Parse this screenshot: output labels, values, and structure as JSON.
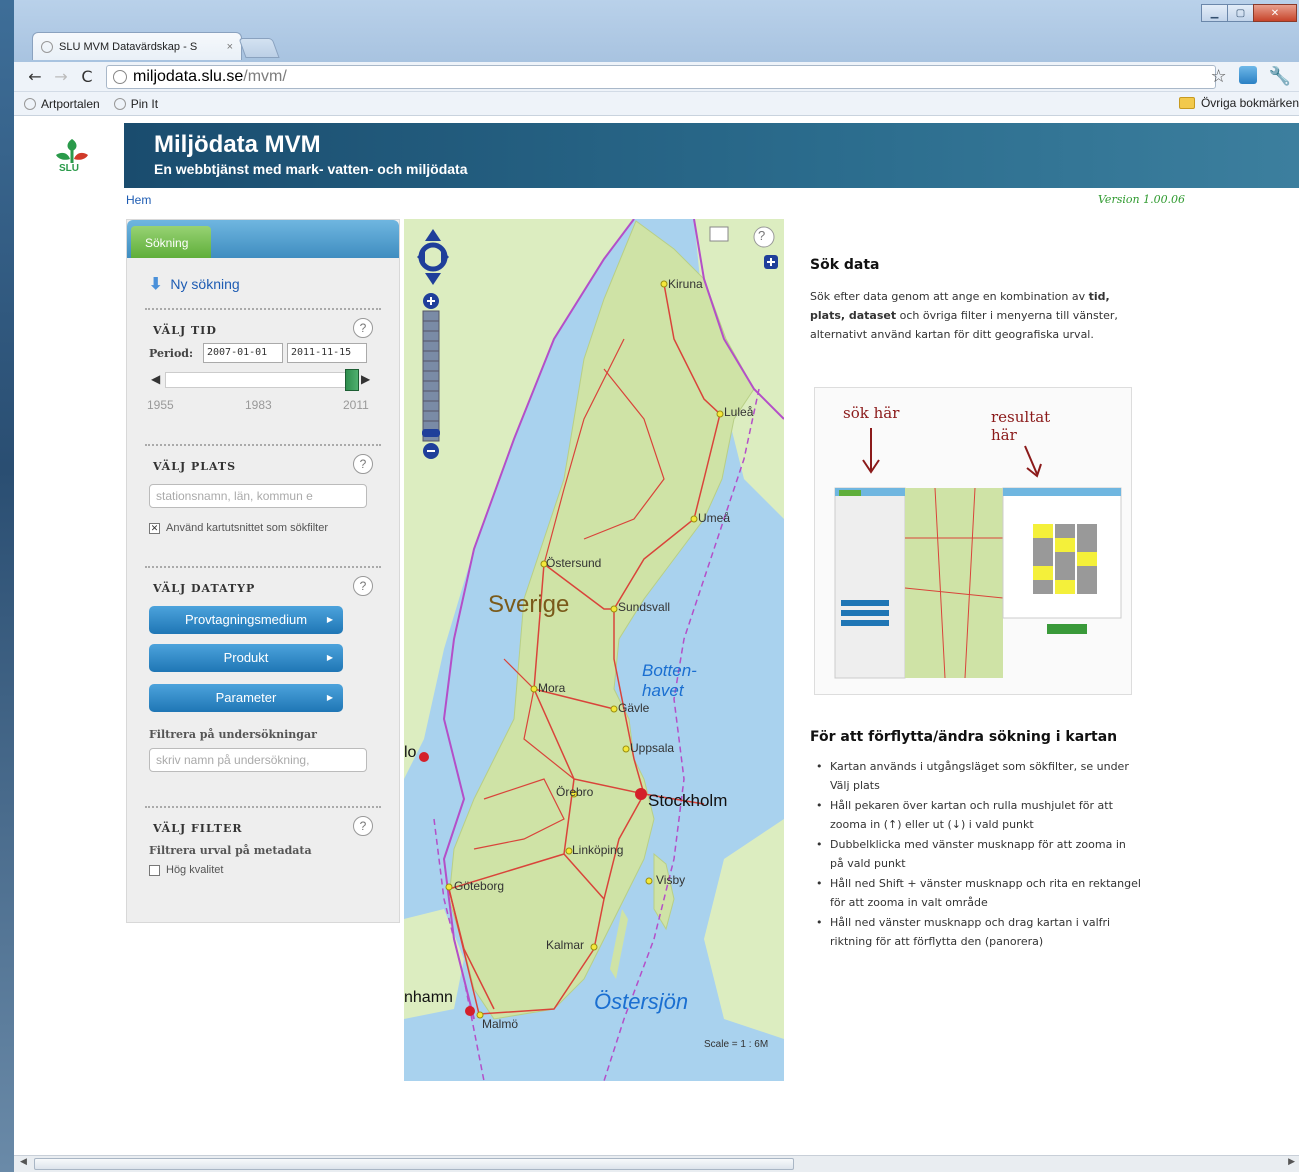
{
  "browser": {
    "tab_title": "SLU MVM Datavärdskap - S",
    "tab_close": "×",
    "url_domain": "miljodata.slu.se",
    "url_path": "/mvm/",
    "bookmarks": [
      "Artportalen",
      "Pin It"
    ],
    "bookmarks_right": "Övriga bokmärken"
  },
  "header": {
    "logo_text": "SLU",
    "title": "Miljödata MVM",
    "subtitle": "En webbtjänst med mark- vatten- och miljödata",
    "home_link": "Hem",
    "version": "Version 1.00.06"
  },
  "sidebar": {
    "tab_label": "Sökning",
    "new_search": "Ny sökning",
    "help_glyph": "?",
    "time": {
      "title": "VÄLJ TID",
      "period_label": "Period:",
      "from_date": "2007-01-01",
      "to_date": "2011-11-15",
      "ticks": [
        "1955",
        "1983",
        "2011"
      ]
    },
    "place": {
      "title": "VÄLJ PLATS",
      "placeholder": "stationsnamn, län, kommun e",
      "checkbox_label": "Använd kartutsnittet som sökfilter",
      "checkbox_checked": true
    },
    "datatype": {
      "title": "VÄLJ DATATYP",
      "buttons": [
        "Provtagningsmedium",
        "Produkt",
        "Parameter"
      ],
      "filter_heading": "Filtrera på undersökningar",
      "filter_placeholder": "skriv namn på undersökning,"
    },
    "filter": {
      "title": "VÄLJ FILTER",
      "subheading": "Filtrera urval på metadata",
      "checkbox_label": "Hög kvalitet",
      "checkbox_checked": false
    }
  },
  "map": {
    "country_label": "Sverige",
    "sea_labels": [
      "Botten-",
      "havet",
      "Östersjön"
    ],
    "cities": [
      "Kiruna",
      "Luleå",
      "Umeå",
      "Östersund",
      "Sundsvall",
      "Mora",
      "Gävle",
      "Uppsala",
      "Örebro",
      "Stockholm",
      "Linköping",
      "Visby",
      "Göteborg",
      "Kalmar",
      "Malmö"
    ],
    "edge_labels": [
      "lo",
      "nhamn"
    ],
    "scale": "Scale = 1 : 6M",
    "help_glyph": "?"
  },
  "info": {
    "heading1": "Sök data",
    "para_pre": "Sök efter data genom att ange en kombination av",
    "para_bold1": "tid, plats, dataset",
    "para_mid": " och övriga filter i menyerna till vänster, alternativt använd kartan för ditt geografiska urval.",
    "illustration_label_left": "sök här",
    "illustration_label_right1": "resultat",
    "illustration_label_right2": "här",
    "heading2": "För att förflytta/ändra sökning i kartan",
    "bullets": [
      "Kartan används i utgångsläget som sökfilter, se under Välj plats",
      "Håll pekaren över kartan och rulla mushjulet för att zooma in (↑) eller ut (↓) i vald punkt",
      "Dubbelklicka med vänster musknapp för att zooma in på vald punkt",
      "Håll ned Shift + vänster musknapp och rita en rektangel för att zooma in valt område",
      "Håll ned vänster musknapp och drag kartan i valfri riktning för att förflytta den (panorera)"
    ]
  },
  "colors": {
    "header_blue": "#2b6c8d",
    "button_blue": "#1f76b5",
    "tab_green": "#5fae3a",
    "land_green": "#cfe3a6",
    "sea_blue": "#a9d2ee",
    "road_red": "#d9443a",
    "border_purple": "#b44fc8"
  }
}
